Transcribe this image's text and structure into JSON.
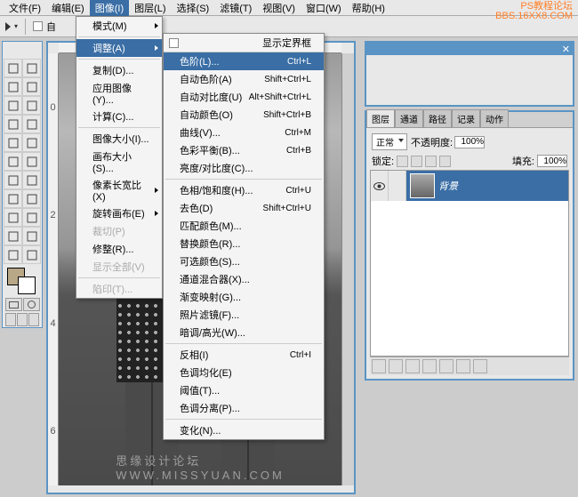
{
  "menubar": [
    "文件(F)",
    "编辑(E)",
    "图像(I)",
    "图层(L)",
    "选择(S)",
    "滤镜(T)",
    "视图(V)",
    "窗口(W)",
    "帮助(H)"
  ],
  "activeMenuIndex": 2,
  "toolbar": {
    "autoLabel": "自"
  },
  "menu1": [
    {
      "label": "模式(M)",
      "arrow": true
    },
    {
      "sep": true
    },
    {
      "label": "调整(A)",
      "arrow": true,
      "hi": true
    },
    {
      "sep": true
    },
    {
      "label": "复制(D)...",
      "arrow": false
    },
    {
      "label": "应用图像(Y)...",
      "arrow": false
    },
    {
      "label": "计算(C)...",
      "arrow": false
    },
    {
      "sep": true
    },
    {
      "label": "图像大小(I)...",
      "arrow": false
    },
    {
      "label": "画布大小(S)...",
      "arrow": false
    },
    {
      "label": "像素长宽比(X)",
      "arrow": true
    },
    {
      "label": "旋转画布(E)",
      "arrow": true
    },
    {
      "label": "裁切(P)",
      "disabled": true
    },
    {
      "label": "修整(R)...",
      "arrow": false
    },
    {
      "label": "显示全部(V)",
      "disabled": true
    },
    {
      "sep": true
    },
    {
      "label": "陷印(T)...",
      "disabled": true
    }
  ],
  "menu2header": "显示定界框",
  "menu2": [
    {
      "label": "色阶(L)...",
      "sc": "Ctrl+L",
      "hi": true
    },
    {
      "label": "自动色阶(A)",
      "sc": "Shift+Ctrl+L"
    },
    {
      "label": "自动对比度(U)",
      "sc": "Alt+Shift+Ctrl+L"
    },
    {
      "label": "自动颜色(O)",
      "sc": "Shift+Ctrl+B"
    },
    {
      "label": "曲线(V)...",
      "sc": "Ctrl+M"
    },
    {
      "label": "色彩平衡(B)...",
      "sc": "Ctrl+B"
    },
    {
      "label": "亮度/对比度(C)...",
      "sc": ""
    },
    {
      "sep": true
    },
    {
      "label": "色相/饱和度(H)...",
      "sc": "Ctrl+U"
    },
    {
      "label": "去色(D)",
      "sc": "Shift+Ctrl+U"
    },
    {
      "label": "匹配颜色(M)...",
      "sc": ""
    },
    {
      "label": "替换颜色(R)...",
      "sc": ""
    },
    {
      "label": "可选颜色(S)...",
      "sc": ""
    },
    {
      "label": "通道混合器(X)...",
      "sc": ""
    },
    {
      "label": "渐变映射(G)...",
      "sc": ""
    },
    {
      "label": "照片滤镜(F)...",
      "sc": ""
    },
    {
      "label": "暗调/高光(W)...",
      "sc": ""
    },
    {
      "sep": true
    },
    {
      "label": "反相(I)",
      "sc": "Ctrl+I"
    },
    {
      "label": "色调均化(E)",
      "sc": ""
    },
    {
      "label": "阈值(T)...",
      "sc": ""
    },
    {
      "label": "色调分离(P)...",
      "sc": ""
    },
    {
      "sep": true
    },
    {
      "label": "变化(N)...",
      "sc": ""
    }
  ],
  "panels": {
    "closeX": "✕",
    "layerTabs": [
      "图层",
      "通道",
      "路径",
      "记录",
      "动作"
    ],
    "blendMode": "正常",
    "opacityLabel": "不透明度:",
    "opacityVal": "100%",
    "lockLabel": "锁定:",
    "fillLabel": "填充:",
    "fillVal": "100%",
    "bgLayer": "背景"
  },
  "ruler": [
    "0",
    "2",
    "4",
    "6"
  ],
  "watermark": {
    "tr1": "PS教程论坛",
    "tr2": "BBS.16XX8.COM",
    "bc": "思缘设计论坛  WWW.MISSYUAN.COM"
  }
}
